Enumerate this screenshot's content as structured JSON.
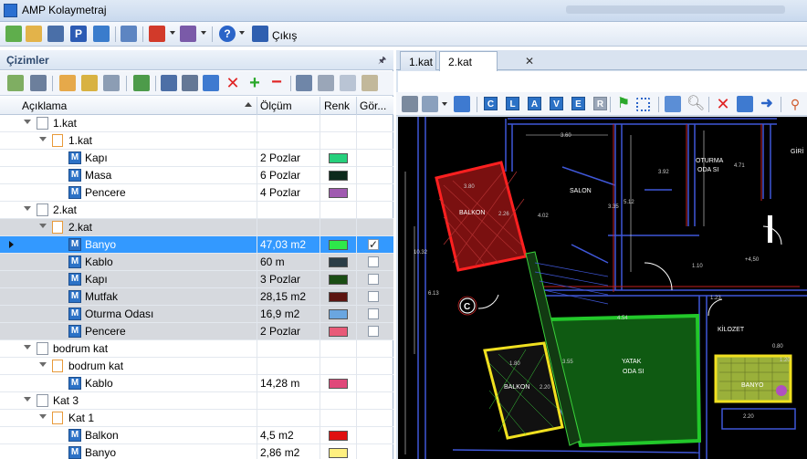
{
  "app": {
    "title": "AMP Kolaymetraj",
    "exit_label": "Çıkış"
  },
  "left_panel": {
    "title": "Çizimler",
    "pin": "🖈"
  },
  "columns": {
    "aciklama": "Açıklama",
    "olcum": "Ölçüm",
    "renk": "Renk",
    "gorunur": "Gör..."
  },
  "rows": [
    {
      "label": "1.kat",
      "value": "",
      "color": "",
      "check": ""
    },
    {
      "label": "1.kat",
      "value": "",
      "color": "",
      "check": ""
    },
    {
      "label": "Kapı",
      "value": "2 Pozlar",
      "color": "#26d07c",
      "check": ""
    },
    {
      "label": "Masa",
      "value": "6 Pozlar",
      "color": "#0d2a1c",
      "check": ""
    },
    {
      "label": "Pencere",
      "value": "4 Pozlar",
      "color": "#a05ab0",
      "check": ""
    },
    {
      "label": "2.kat",
      "value": "",
      "color": "",
      "check": ""
    },
    {
      "label": "2.kat",
      "value": "",
      "color": "",
      "check": ""
    },
    {
      "label": "Banyo",
      "value": "47,03 m2",
      "color": "#2ee84a",
      "check": "✓"
    },
    {
      "label": "Kablo",
      "value": "60 m",
      "color": "#2b3e47",
      "check": ""
    },
    {
      "label": "Kapı",
      "value": "3 Pozlar",
      "color": "#1a4d14",
      "check": ""
    },
    {
      "label": "Mutfak",
      "value": "28,15 m2",
      "color": "#5c1410",
      "check": ""
    },
    {
      "label": "Oturma Odası",
      "value": "16,9 m2",
      "color": "#6aa6e0",
      "check": ""
    },
    {
      "label": "Pencere",
      "value": "2 Pozlar",
      "color": "#e85a78",
      "check": ""
    },
    {
      "label": "bodrum kat",
      "value": "",
      "color": "",
      "check": ""
    },
    {
      "label": "bodrum kat",
      "value": "",
      "color": "",
      "check": ""
    },
    {
      "label": "Kablo",
      "value": "14,28 m",
      "color": "#e0487a",
      "check": ""
    },
    {
      "label": "Kat 3",
      "value": "",
      "color": "",
      "check": ""
    },
    {
      "label": "Kat 1",
      "value": "",
      "color": "",
      "check": ""
    },
    {
      "label": "Balkon",
      "value": "4,5 m2",
      "color": "#e01010",
      "check": ""
    },
    {
      "label": "Banyo",
      "value": "2,86 m2",
      "color": "#fff080",
      "check": ""
    }
  ],
  "tabs": [
    {
      "label": "1.kat"
    },
    {
      "label": "2.kat",
      "close": "✕"
    }
  ],
  "cad_letters": [
    "C",
    "L",
    "A",
    "V",
    "E",
    "R"
  ],
  "drawing": {
    "rooms": {
      "salon": "SALON",
      "oturma": "OTURMA",
      "odasi": "ODA SI",
      "giri": "GİRİ",
      "balkon1": "BALKON",
      "yatak": "YATAK",
      "yatak2": "ODA SI",
      "balkon2": "BALKON",
      "banyo": "BANYO",
      "kilozet": "KİLOZET"
    },
    "dims": [
      "3.60",
      "3.80",
      "2.26",
      "4.02",
      "5.12",
      "3.92",
      "3.35",
      "4.71",
      "10.32",
      "6.13",
      "1.10",
      "1.23",
      "+4,50",
      "4.54",
      "1.80",
      "2.20",
      "3.55",
      "0.80",
      "1.20",
      "2.20"
    ],
    "marker": "C"
  }
}
